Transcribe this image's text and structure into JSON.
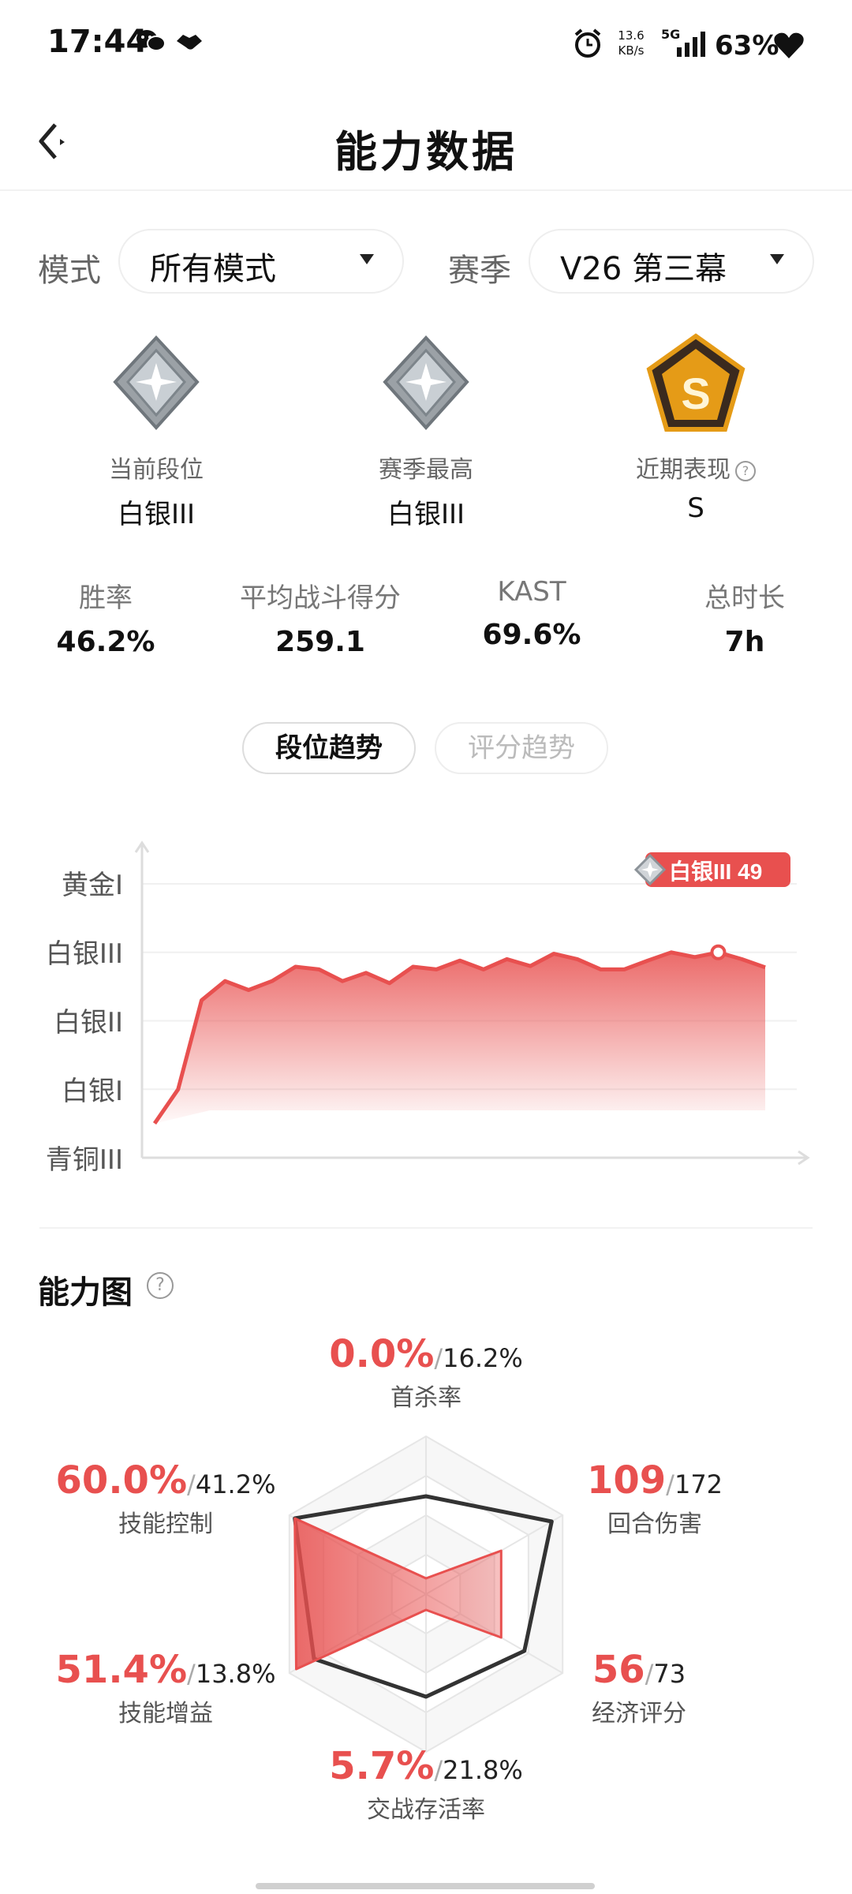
{
  "status_bar": {
    "time": "17:44",
    "net_speed_value": "13.6",
    "net_speed_unit": "KB/s",
    "network": "5G",
    "battery": "63%",
    "icons": [
      "wechat-icon",
      "handshake-icon",
      "alarm-icon",
      "signal-icon",
      "heart-icon"
    ]
  },
  "header": {
    "title": "能力数据",
    "back_icon": "back-icon"
  },
  "filters": {
    "mode_label": "模式",
    "mode_value": "所有模式",
    "season_label": "赛季",
    "season_value": "V26 第三幕"
  },
  "ranks": [
    {
      "label": "当前段位",
      "value": "白银III",
      "icon": "silver-rank-icon"
    },
    {
      "label": "赛季最高",
      "value": "白银III",
      "icon": "silver-rank-icon"
    },
    {
      "label": "近期表现",
      "value": "S",
      "icon": "s-performance-badge-icon"
    }
  ],
  "stats": [
    {
      "label": "胜率",
      "value": "46.2%"
    },
    {
      "label": "平均战斗得分",
      "value": "259.1"
    },
    {
      "label": "KAST",
      "value": "69.6%"
    },
    {
      "label": "总时长",
      "value": "7h"
    }
  ],
  "tabs": [
    {
      "label": "段位趋势",
      "active": true
    },
    {
      "label": "评分趋势",
      "active": false
    }
  ],
  "trend_chart": {
    "type": "area",
    "y_ticks": [
      "黄金I",
      "白银III",
      "白银II",
      "白银I",
      "青铜III"
    ],
    "current_tooltip": "白银III 49",
    "accent": "#e8504f",
    "series": [
      {
        "values": [
          0.5,
          1.0,
          2.3,
          2.58,
          2.45,
          2.58,
          2.79,
          2.75,
          2.58,
          2.7,
          2.55,
          2.79,
          2.75,
          2.88,
          2.75,
          2.9,
          2.8,
          2.98,
          2.9,
          2.75,
          2.75,
          2.88,
          3.0,
          2.93,
          3.0,
          2.9,
          2.78
        ]
      }
    ]
  },
  "ability": {
    "title": "能力图",
    "help_icon": "help-icon",
    "axes": [
      {
        "name": "首杀率",
        "value": "0.0%",
        "avg": "16.2%",
        "player": 0.0,
        "avg_level": 0.62
      },
      {
        "name": "回合伤害",
        "value": "109",
        "avg": "172",
        "player": 0.55,
        "avg_level": 0.92
      },
      {
        "name": "经济评分",
        "value": "56",
        "avg": "73",
        "player": 0.55,
        "avg_level": 0.72
      },
      {
        "name": "交战存活率",
        "value": "5.7%",
        "avg": "21.8%",
        "player": 0.1,
        "avg_level": 0.65
      },
      {
        "name": "技能增益",
        "value": "51.4%",
        "avg": "13.8%",
        "player": 0.95,
        "avg_level": 0.82
      },
      {
        "name": "技能控制",
        "value": "60.0%",
        "avg": "41.2%",
        "player": 0.96,
        "avg_level": 0.96
      }
    ],
    "player_color": "#e8504f",
    "avg_color": "#333333"
  }
}
